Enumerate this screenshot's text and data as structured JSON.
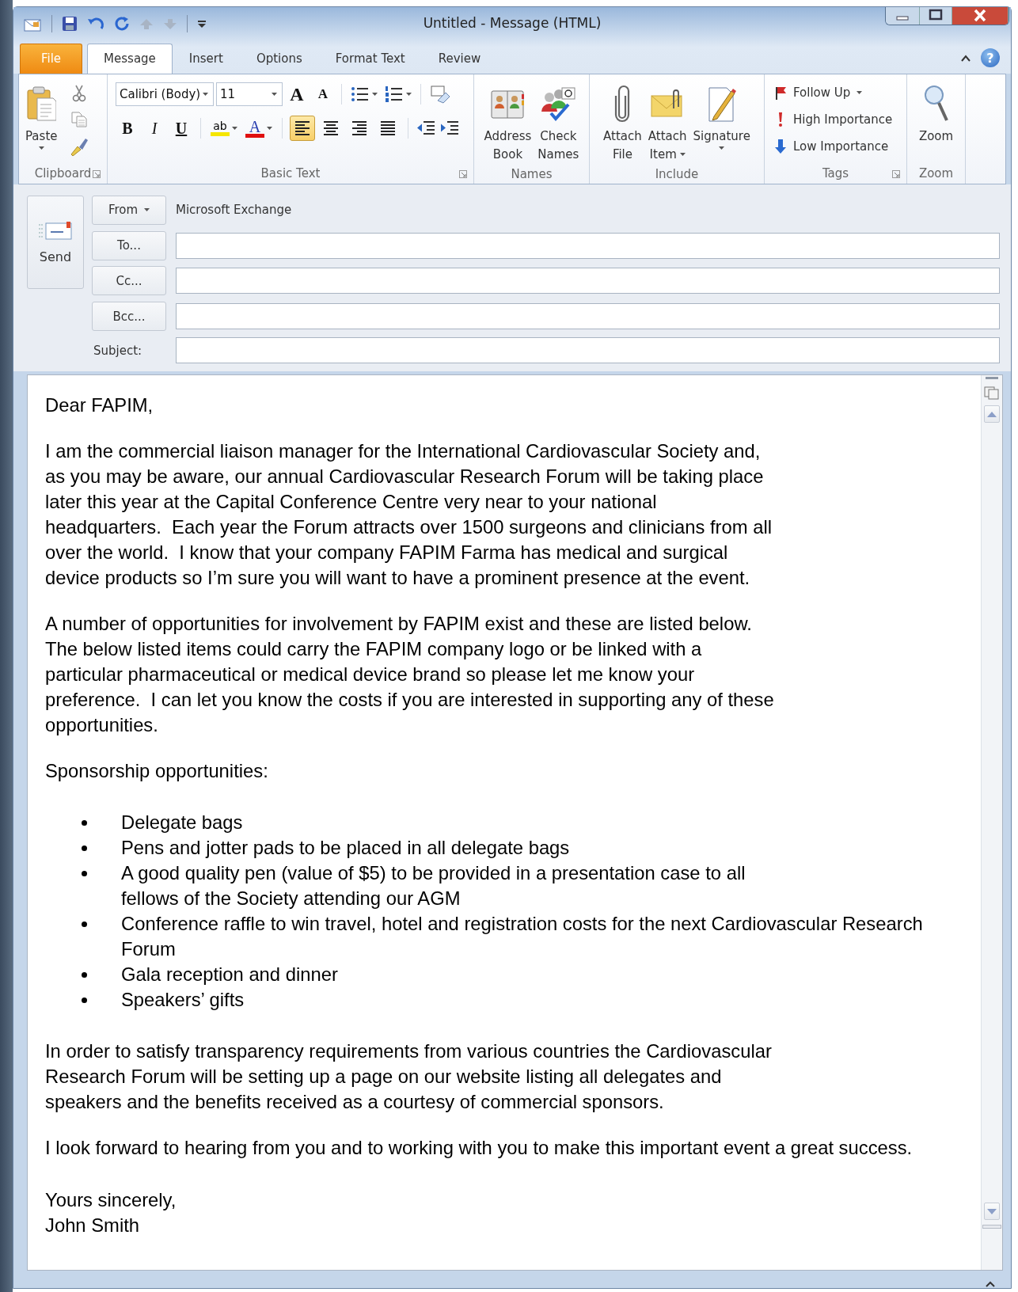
{
  "window": {
    "title": "Untitled  -  Message (HTML)",
    "help": "?"
  },
  "tabs": [
    {
      "label": "File",
      "kind": "file",
      "selected": false
    },
    {
      "label": "Message",
      "kind": "tab",
      "selected": true
    },
    {
      "label": "Insert",
      "kind": "tab",
      "selected": false
    },
    {
      "label": "Options",
      "kind": "tab",
      "selected": false
    },
    {
      "label": "Format Text",
      "kind": "tab",
      "selected": false
    },
    {
      "label": "Review",
      "kind": "tab",
      "selected": false
    }
  ],
  "ribbon": {
    "groups": [
      {
        "kind": "clipboard",
        "label": "Clipboard",
        "launcher": true,
        "items": [
          {
            "lines": [
              "Paste"
            ],
            "dropdown": true
          }
        ]
      },
      {
        "kind": "basic-text",
        "label": "Basic Text",
        "launcher": true,
        "font_name": "Calibri (Body)",
        "font_size": "11",
        "grow": "A",
        "shrink": "A",
        "format": [
          {
            "glyph": "B"
          },
          {
            "glyph": "I"
          },
          {
            "glyph": "U"
          }
        ],
        "highlight": "ab",
        "font_color": "A",
        "align": [
          {
            "selected": true
          },
          {
            "selected": false
          },
          {
            "selected": false
          },
          {
            "selected": false
          }
        ]
      },
      {
        "kind": "large",
        "label": "Names",
        "launcher": false,
        "items": [
          {
            "lines": [
              "Address",
              "Book"
            ],
            "dropdown": false
          },
          {
            "lines": [
              "Check",
              "Names"
            ],
            "dropdown": false
          }
        ]
      },
      {
        "kind": "large",
        "label": "Include",
        "launcher": false,
        "items": [
          {
            "lines": [
              "Attach",
              "File"
            ],
            "dropdown": false
          },
          {
            "lines": [
              "Attach",
              "Item"
            ],
            "dropdown": true
          },
          {
            "lines": [
              "Signature"
            ],
            "dropdown": true
          }
        ]
      },
      {
        "kind": "list",
        "label": "Tags",
        "launcher": true,
        "items": [
          {
            "label": "Follow Up",
            "dropdown": true
          },
          {
            "label": "High Importance",
            "dropdown": false
          },
          {
            "label": "Low Importance",
            "dropdown": false
          }
        ]
      },
      {
        "kind": "large",
        "label": "Zoom",
        "launcher": false,
        "items": [
          {
            "lines": [
              "Zoom"
            ],
            "dropdown": false
          }
        ]
      }
    ]
  },
  "header": {
    "send": "Send",
    "from": {
      "label": "From",
      "value": "Microsoft Exchange"
    },
    "fields": [
      {
        "label": "To...",
        "kind": "button"
      },
      {
        "label": "Cc...",
        "kind": "button"
      },
      {
        "label": "Bcc...",
        "kind": "button"
      },
      {
        "label": "Subject:",
        "kind": "label"
      }
    ]
  },
  "body": {
    "blocks": [
      {
        "kind": "paragraph",
        "lines": [
          "Dear FAPIM,"
        ]
      },
      {
        "kind": "paragraph",
        "lines": [
          "I am the commercial liaison manager for the International Cardiovascular Society and,",
          "as you may be aware, our annual Cardiovascular Research Forum will be taking place",
          "later this year at the Capital Conference Centre very near to your national",
          "headquarters.  Each year the Forum attracts over 1500 surgeons and clinicians from all",
          "over the world.  I know that your company FAPIM Farma has medical and surgical",
          "device products so I’m sure you will want to have a prominent presence at the event."
        ]
      },
      {
        "kind": "paragraph",
        "lines": [
          "A number of opportunities for involvement by FAPIM exist and these are listed below.",
          "The below listed items could carry the FAPIM company logo or be linked with a",
          "particular pharmaceutical or medical device brand so please let me know your",
          "preference.  I can let you know the costs if you are interested in supporting any of these",
          "opportunities."
        ]
      },
      {
        "kind": "paragraph",
        "lines": [
          "Sponsorship opportunities:"
        ]
      },
      {
        "kind": "bullets",
        "items": [
          {
            "lines": [
              "Delegate bags"
            ]
          },
          {
            "lines": [
              "Pens and jotter pads to be placed in all delegate bags"
            ]
          },
          {
            "lines": [
              "A good quality pen (value of $5) to be provided in a presentation case to all",
              "fellows of the Society attending our AGM"
            ]
          },
          {
            "lines": [
              "Conference raffle to win travel, hotel and registration costs for the next Cardiovascular Research",
              "Forum"
            ]
          },
          {
            "lines": [
              "Gala reception and dinner"
            ]
          },
          {
            "lines": [
              "Speakers’ gifts"
            ]
          }
        ]
      },
      {
        "kind": "paragraph",
        "lines": [
          "In order to satisfy transparency requirements from various countries the Cardiovascular",
          "Research Forum will be setting up a page on our website listing all delegates and",
          "speakers and the benefits received as a courtesy of commercial sponsors."
        ]
      },
      {
        "kind": "paragraph",
        "lines": [
          "I look forward to hearing from you and to working with you to make this important event a great success."
        ]
      },
      {
        "kind": "closing",
        "lines": [
          "Yours sincerely,",
          "John Smith"
        ]
      }
    ]
  }
}
